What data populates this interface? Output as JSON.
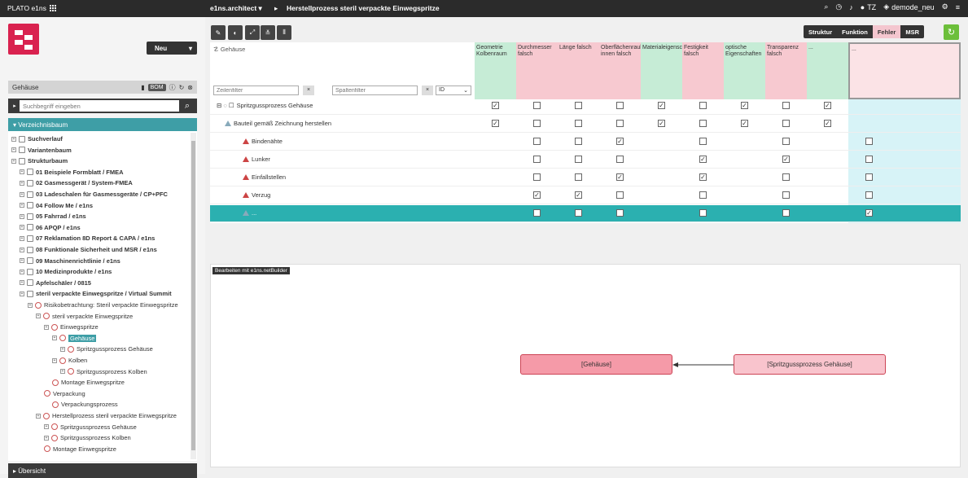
{
  "topbar": {
    "app_title": "PLATO e1ns",
    "module": "e1ns.architect ▾",
    "separator": "▸",
    "process_title": "Herstellprozess steril verpackte Einwegspritze",
    "user": "TZ",
    "database": "demode_neu",
    "icons": [
      "search-icon",
      "clock-icon",
      "bell-icon",
      "user-icon",
      "database-icon",
      "settings-icon",
      "menu-icon"
    ]
  },
  "left": {
    "new_button": "Neu",
    "panel_title": "Gehäuse",
    "bom_label": "BOM",
    "search_placeholder": "Suchbegriff eingeben",
    "tree_header": "Verzeichnisbaum",
    "footer": "Übersicht",
    "tree": [
      {
        "label": "Suchverlauf",
        "bold": true
      },
      {
        "label": "Variantenbaum",
        "bold": true
      },
      {
        "label": "Strukturbaum",
        "bold": true
      },
      {
        "label": "01 Beispiele Formblatt / FMEA",
        "bold": true
      },
      {
        "label": "02 Gasmessgerät / System-FMEA",
        "bold": true
      },
      {
        "label": "03 Ladeschalen für Gasmessgeräte / CP+PFC",
        "bold": true
      },
      {
        "label": "04 Follow Me / e1ns",
        "bold": true
      },
      {
        "label": "05 Fahrrad / e1ns",
        "bold": true
      },
      {
        "label": "06 APQP / e1ns",
        "bold": true
      },
      {
        "label": "07 Reklamation 8D Report & CAPA / e1ns",
        "bold": true
      },
      {
        "label": "08 Funktionale Sicherheit und MSR / e1ns",
        "bold": true
      },
      {
        "label": "09 Maschinenrichtlinie / e1ns",
        "bold": true
      },
      {
        "label": "10 Medizinprodukte / e1ns",
        "bold": true
      },
      {
        "label": "Apfelschäler / 0815",
        "bold": true
      },
      {
        "label": "steril verpackte Einwegspritze / Virtual Summit",
        "bold": true
      },
      {
        "label": "Risikobetrachtung: Steril verpackte Einwegspritze",
        "bold": false
      },
      {
        "label": "steril verpackte Einwegspritze",
        "bold": false
      },
      {
        "label": "Einwegspritze",
        "bold": false
      },
      {
        "label": "Gehäuse",
        "bold": false,
        "selected": true
      },
      {
        "label": "Spritzgussprozess Gehäuse",
        "bold": false
      },
      {
        "label": "Kolben",
        "bold": false
      },
      {
        "label": "Spritzgussprozess Kolben",
        "bold": false
      },
      {
        "label": "Montage Einwegspritze",
        "bold": false
      },
      {
        "label": "Verpackung",
        "bold": false
      },
      {
        "label": "Verpackungsprozess",
        "bold": false
      },
      {
        "label": "Herstellprozess steril verpackte Einwegspritze",
        "bold": false
      },
      {
        "label": "Spritzgussprozess Gehäuse",
        "bold": false
      },
      {
        "label": "Spritzgussprozess Kolben",
        "bold": false
      },
      {
        "label": "Montage Einwegspritze",
        "bold": false
      }
    ]
  },
  "views": {
    "struktur": "Struktur",
    "funktion": "Funktion",
    "fehler": "Fehler",
    "msr": "MSR"
  },
  "matrix": {
    "title": "Gehäuse",
    "row_filter_placeholder": "Zeilenfilter",
    "col_filter_placeholder": "Spaltenfilter",
    "id_select": "ID",
    "columns": [
      "Geometrie Kolbenraum",
      "Durchmesser falsch",
      "Länge falsch",
      "Oberflächenrauhigkeit innen falsch",
      "Materialeigenschaften",
      "Festigkeit falsch",
      "optische Eigenschaften",
      "Transparenz falsch",
      "...",
      "..."
    ],
    "rows": [
      {
        "label": "Spritzgussprozess Gehäuse",
        "checks": [
          1,
          0,
          0,
          0,
          1,
          0,
          1,
          0,
          1,
          null
        ]
      },
      {
        "label": "Bauteil gemäß Zeichnung herstellen",
        "checks": [
          1,
          0,
          0,
          0,
          1,
          0,
          1,
          0,
          1,
          null
        ]
      },
      {
        "label": "Bindenähte",
        "checks": [
          null,
          0,
          0,
          1,
          null,
          0,
          null,
          0,
          null,
          0
        ]
      },
      {
        "label": "Lunker",
        "checks": [
          null,
          0,
          0,
          0,
          null,
          1,
          null,
          1,
          null,
          0
        ]
      },
      {
        "label": "Einfallstellen",
        "checks": [
          null,
          0,
          0,
          1,
          null,
          1,
          null,
          0,
          null,
          0
        ]
      },
      {
        "label": "Verzug",
        "checks": [
          null,
          1,
          1,
          0,
          null,
          0,
          null,
          0,
          null,
          0
        ]
      },
      {
        "label": "...",
        "checks": [
          null,
          0,
          0,
          0,
          null,
          0,
          null,
          0,
          null,
          1
        ]
      }
    ]
  },
  "editor": {
    "tag": "Bearbeiten mit e1ns.netBuilder",
    "node_left": "[Gehäuse]",
    "node_right": "[Spritzgussprozess Gehäuse]"
  }
}
